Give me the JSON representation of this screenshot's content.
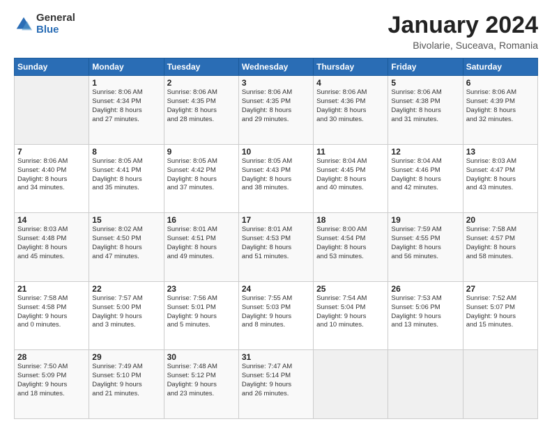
{
  "logo": {
    "general": "General",
    "blue": "Blue"
  },
  "header": {
    "title": "January 2024",
    "subtitle": "Bivolarie, Suceava, Romania"
  },
  "weekdays": [
    "Sunday",
    "Monday",
    "Tuesday",
    "Wednesday",
    "Thursday",
    "Friday",
    "Saturday"
  ],
  "weeks": [
    [
      {
        "day": "",
        "text": ""
      },
      {
        "day": "1",
        "text": "Sunrise: 8:06 AM\nSunset: 4:34 PM\nDaylight: 8 hours\nand 27 minutes."
      },
      {
        "day": "2",
        "text": "Sunrise: 8:06 AM\nSunset: 4:35 PM\nDaylight: 8 hours\nand 28 minutes."
      },
      {
        "day": "3",
        "text": "Sunrise: 8:06 AM\nSunset: 4:35 PM\nDaylight: 8 hours\nand 29 minutes."
      },
      {
        "day": "4",
        "text": "Sunrise: 8:06 AM\nSunset: 4:36 PM\nDaylight: 8 hours\nand 30 minutes."
      },
      {
        "day": "5",
        "text": "Sunrise: 8:06 AM\nSunset: 4:38 PM\nDaylight: 8 hours\nand 31 minutes."
      },
      {
        "day": "6",
        "text": "Sunrise: 8:06 AM\nSunset: 4:39 PM\nDaylight: 8 hours\nand 32 minutes."
      }
    ],
    [
      {
        "day": "7",
        "text": "Sunrise: 8:06 AM\nSunset: 4:40 PM\nDaylight: 8 hours\nand 34 minutes."
      },
      {
        "day": "8",
        "text": "Sunrise: 8:05 AM\nSunset: 4:41 PM\nDaylight: 8 hours\nand 35 minutes."
      },
      {
        "day": "9",
        "text": "Sunrise: 8:05 AM\nSunset: 4:42 PM\nDaylight: 8 hours\nand 37 minutes."
      },
      {
        "day": "10",
        "text": "Sunrise: 8:05 AM\nSunset: 4:43 PM\nDaylight: 8 hours\nand 38 minutes."
      },
      {
        "day": "11",
        "text": "Sunrise: 8:04 AM\nSunset: 4:45 PM\nDaylight: 8 hours\nand 40 minutes."
      },
      {
        "day": "12",
        "text": "Sunrise: 8:04 AM\nSunset: 4:46 PM\nDaylight: 8 hours\nand 42 minutes."
      },
      {
        "day": "13",
        "text": "Sunrise: 8:03 AM\nSunset: 4:47 PM\nDaylight: 8 hours\nand 43 minutes."
      }
    ],
    [
      {
        "day": "14",
        "text": "Sunrise: 8:03 AM\nSunset: 4:48 PM\nDaylight: 8 hours\nand 45 minutes."
      },
      {
        "day": "15",
        "text": "Sunrise: 8:02 AM\nSunset: 4:50 PM\nDaylight: 8 hours\nand 47 minutes."
      },
      {
        "day": "16",
        "text": "Sunrise: 8:01 AM\nSunset: 4:51 PM\nDaylight: 8 hours\nand 49 minutes."
      },
      {
        "day": "17",
        "text": "Sunrise: 8:01 AM\nSunset: 4:53 PM\nDaylight: 8 hours\nand 51 minutes."
      },
      {
        "day": "18",
        "text": "Sunrise: 8:00 AM\nSunset: 4:54 PM\nDaylight: 8 hours\nand 53 minutes."
      },
      {
        "day": "19",
        "text": "Sunrise: 7:59 AM\nSunset: 4:55 PM\nDaylight: 8 hours\nand 56 minutes."
      },
      {
        "day": "20",
        "text": "Sunrise: 7:58 AM\nSunset: 4:57 PM\nDaylight: 8 hours\nand 58 minutes."
      }
    ],
    [
      {
        "day": "21",
        "text": "Sunrise: 7:58 AM\nSunset: 4:58 PM\nDaylight: 9 hours\nand 0 minutes."
      },
      {
        "day": "22",
        "text": "Sunrise: 7:57 AM\nSunset: 5:00 PM\nDaylight: 9 hours\nand 3 minutes."
      },
      {
        "day": "23",
        "text": "Sunrise: 7:56 AM\nSunset: 5:01 PM\nDaylight: 9 hours\nand 5 minutes."
      },
      {
        "day": "24",
        "text": "Sunrise: 7:55 AM\nSunset: 5:03 PM\nDaylight: 9 hours\nand 8 minutes."
      },
      {
        "day": "25",
        "text": "Sunrise: 7:54 AM\nSunset: 5:04 PM\nDaylight: 9 hours\nand 10 minutes."
      },
      {
        "day": "26",
        "text": "Sunrise: 7:53 AM\nSunset: 5:06 PM\nDaylight: 9 hours\nand 13 minutes."
      },
      {
        "day": "27",
        "text": "Sunrise: 7:52 AM\nSunset: 5:07 PM\nDaylight: 9 hours\nand 15 minutes."
      }
    ],
    [
      {
        "day": "28",
        "text": "Sunrise: 7:50 AM\nSunset: 5:09 PM\nDaylight: 9 hours\nand 18 minutes."
      },
      {
        "day": "29",
        "text": "Sunrise: 7:49 AM\nSunset: 5:10 PM\nDaylight: 9 hours\nand 21 minutes."
      },
      {
        "day": "30",
        "text": "Sunrise: 7:48 AM\nSunset: 5:12 PM\nDaylight: 9 hours\nand 23 minutes."
      },
      {
        "day": "31",
        "text": "Sunrise: 7:47 AM\nSunset: 5:14 PM\nDaylight: 9 hours\nand 26 minutes."
      },
      {
        "day": "",
        "text": ""
      },
      {
        "day": "",
        "text": ""
      },
      {
        "day": "",
        "text": ""
      }
    ]
  ]
}
